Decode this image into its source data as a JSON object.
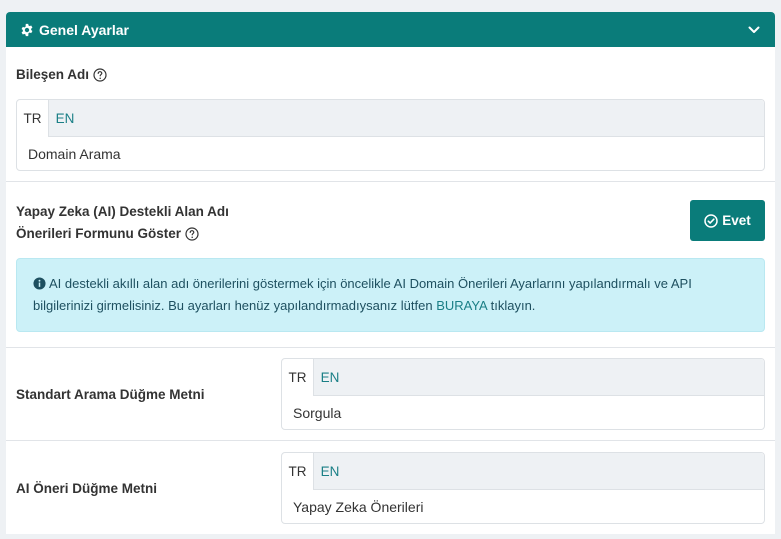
{
  "header": {
    "title": "Genel Ayarlar"
  },
  "component_name": {
    "label": "Bileşen Adı",
    "tabs": [
      "TR",
      "EN"
    ],
    "value": "Domain Arama"
  },
  "ai_form": {
    "label_line1": "Yapay Zeka (AI) Destekli Alan Adı",
    "label_line2": "Önerileri Formunu Göster",
    "toggle_label": "Evet"
  },
  "alert": {
    "text_before": "AI destekli akıllı alan adı önerilerini göstermek için öncelikle AI Domain Önerileri Ayarlarını yapılandırmalı ve API bilgilerinizi girmelisiniz. Bu ayarları henüz yapılandırmadıysanız lütfen ",
    "link": "BURAYA",
    "text_after": " tıklayın."
  },
  "standard_button": {
    "label": "Standart Arama Düğme Metni",
    "tabs": [
      "TR",
      "EN"
    ],
    "value": "Sorgula"
  },
  "ai_button": {
    "label": "AI Öneri Düğme Metni",
    "tabs": [
      "TR",
      "EN"
    ],
    "value": "Yapay Zeka Önerileri"
  },
  "colors": {
    "primary": "#0a7c7a",
    "alert_bg": "#ccf1f8",
    "link": "#1a7f86"
  }
}
